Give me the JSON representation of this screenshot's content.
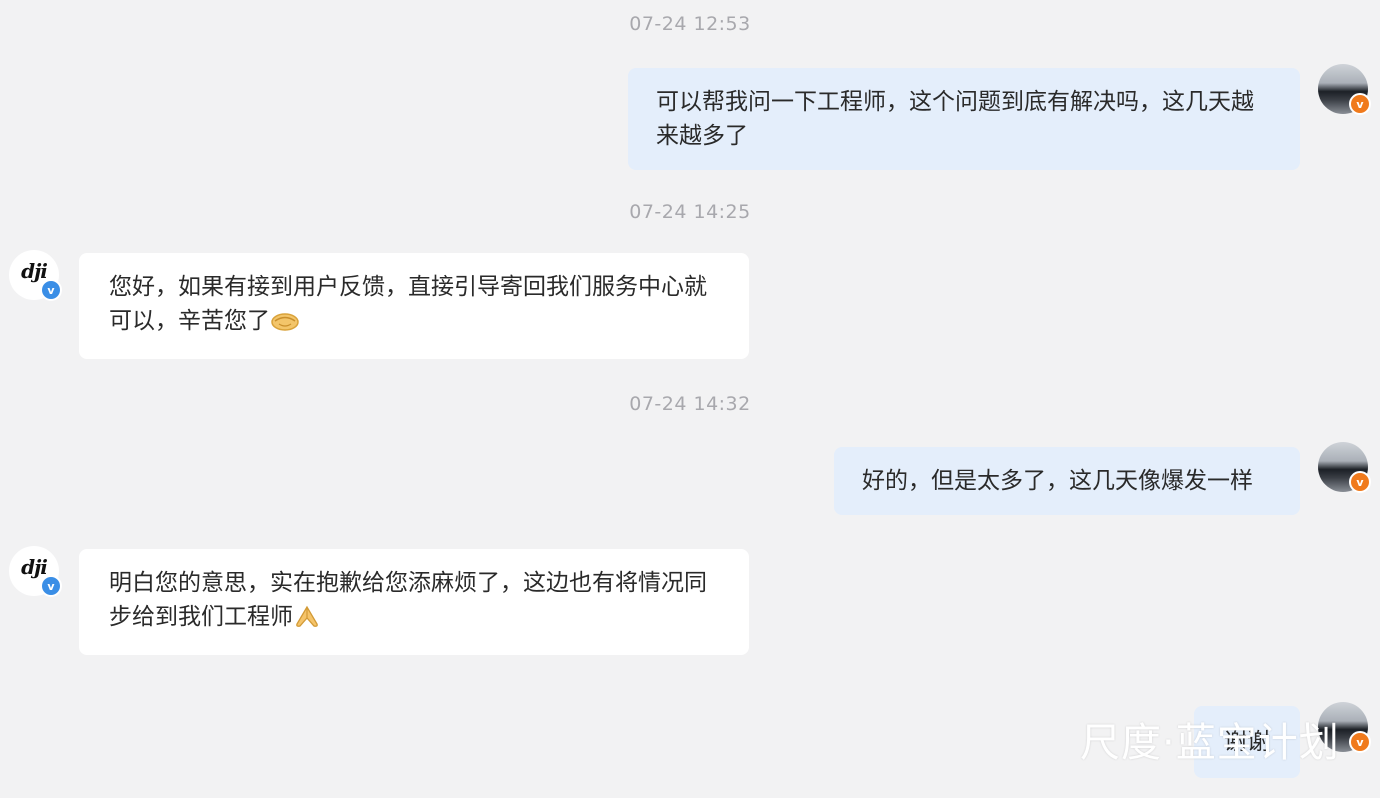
{
  "conversation": {
    "messages": [
      {
        "timestamp": "07-24 12:53",
        "sender": "user",
        "text": "可以帮我问一下工程师，这个问题到底有解决吗，这几天越来越多了"
      },
      {
        "timestamp": "07-24 14:25",
        "sender": "dji",
        "text": "您好，如果有接到用户反馈，直接引导寄回我们服务中心就可以，辛苦您了"
      },
      {
        "timestamp": "07-24 14:32",
        "sender": "user",
        "text": "好的，但是太多了，这几天像爆发一样"
      },
      {
        "timestamp": "",
        "sender": "dji",
        "text": "明白您的意思，实在抱歉给您添麻烦了，这边也有将情况同步给到我们工程师"
      },
      {
        "timestamp": "",
        "sender": "user",
        "text": "谢谢"
      }
    ]
  },
  "avatars": {
    "dji_logo": "dji",
    "user_badge": "v",
    "dji_badge": "v"
  },
  "colors": {
    "background": "#f2f2f3",
    "right_bubble": "#e4eefb",
    "left_bubble": "#ffffff",
    "timestamp": "#a8a8ad",
    "user_badge": "#f07a1c",
    "dji_badge": "#3a8ee6"
  },
  "watermark": "尺度·蓝宝计划"
}
